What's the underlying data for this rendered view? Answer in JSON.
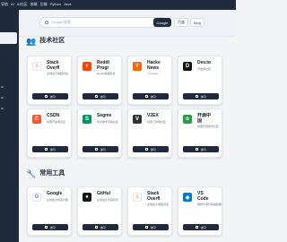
{
  "topbar": {
    "nav": [
      "导航",
      "AI",
      "AI社区",
      "前端",
      "后端",
      "Python",
      "Java"
    ]
  },
  "search": {
    "placeholder": "Google 搜索",
    "engines": [
      "Google",
      "百度",
      "Bing"
    ]
  },
  "sections": [
    {
      "emoji": "👥",
      "title": "技术社区",
      "cards": [
        {
          "name": "Stack",
          "name2": "Overfl",
          "desc": "全球最大编程问答",
          "icon_letter": "≡",
          "icon_color": "#f48024",
          "icon_bg": "#ffffff",
          "button": "访问"
        },
        {
          "name": "Reddi",
          "name2": "Progr",
          "desc": "Reddit编程社区",
          "icon_letter": "r",
          "icon_color": "#ffffff",
          "icon_bg": "#ff4500",
          "button": "访问"
        },
        {
          "name": "Hacke",
          "name2": "News",
          "desc": "Y Combi…",
          "icon_letter": "Y",
          "icon_color": "#ffffff",
          "icon_bg": "#ff6600",
          "button": "访问"
        },
        {
          "name": "Dev.to",
          "name2": "",
          "desc": "开发者社区",
          "icon_letter": "D",
          "icon_color": "#ffffff",
          "icon_bg": "#111111",
          "button": "访问"
        },
        {
          "name": "CSDN",
          "name2": "",
          "desc": "中国开发者社区",
          "icon_letter": "C",
          "icon_color": "#ffffff",
          "icon_bg": "#fc5531",
          "button": "访问"
        },
        {
          "name": "Segme",
          "name2": "",
          "desc": "中文技术问答社区",
          "icon_letter": "S",
          "icon_color": "#ffffff",
          "icon_bg": "#00965e",
          "button": "访问"
        },
        {
          "name": "V2EX",
          "name2": "",
          "desc": "创意工作者社区",
          "icon_letter": "V",
          "icon_color": "#ffffff",
          "icon_bg": "#333333",
          "button": "访问"
        },
        {
          "name": "开源中",
          "name2": "国",
          "desc": "中国开源技术社区",
          "icon_letter": "o",
          "icon_color": "#ffffff",
          "icon_bg": "#2e9a47",
          "button": "访问"
        }
      ]
    },
    {
      "emoji": "🔧",
      "title": "常用工具",
      "cards": [
        {
          "name": "Google",
          "name2": "",
          "desc": "全球最大搜索引擎",
          "icon_letter": "G",
          "icon_color": "#4285f4",
          "icon_bg": "#ffffff",
          "button": "访问"
        },
        {
          "name": "GitHul",
          "name2": "",
          "desc": "全球最大代码托管",
          "icon_letter": "●",
          "icon_color": "#ffffff",
          "icon_bg": "#181717",
          "button": "访问"
        },
        {
          "name": "Stack",
          "name2": "Overfl",
          "desc": "全球最大编程问答",
          "icon_letter": "≡",
          "icon_color": "#f48024",
          "icon_bg": "#ffffff",
          "button": "访问"
        },
        {
          "name": "VS",
          "name2": "Code",
          "desc": "微软开源代码编辑器",
          "icon_letter": "◆",
          "icon_color": "#ffffff",
          "icon_bg": "#007acc",
          "button": "访问"
        }
      ]
    }
  ]
}
